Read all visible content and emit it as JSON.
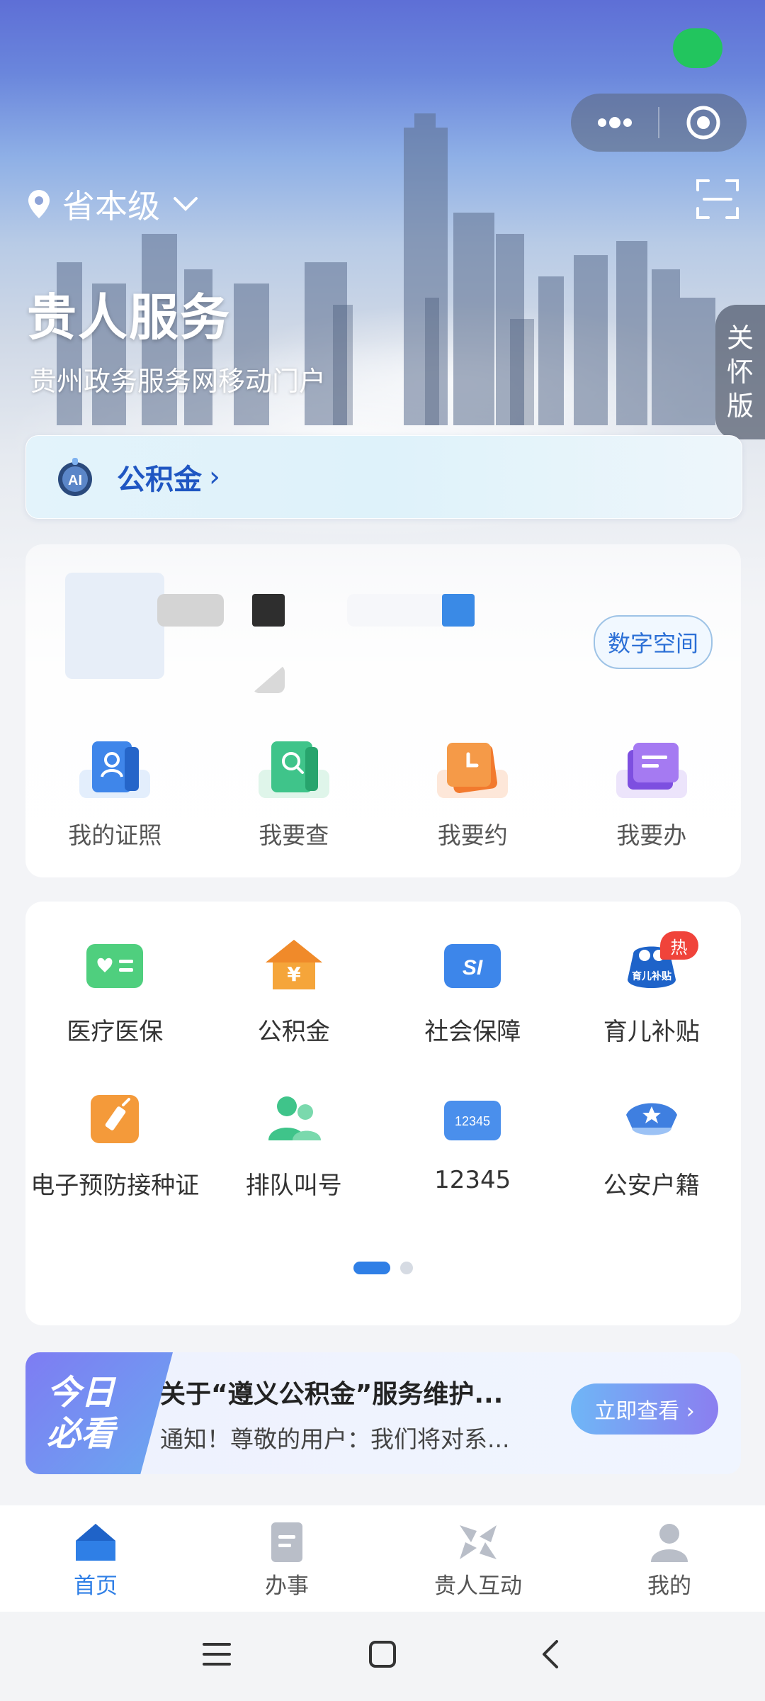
{
  "colors": {
    "accent": "#2f7fe6",
    "status_capsule": "#22c55e",
    "hot_badge": "#f0433a",
    "ai_label": "#1f56c2"
  },
  "header": {
    "location": "省本级",
    "title": "贵人服务",
    "subtitle": "贵州政务服务网移动门户",
    "care_mode": [
      "关",
      "怀",
      "版"
    ]
  },
  "ai_bar": {
    "label": "公积金",
    "arrow": "›"
  },
  "account_card": {
    "digital_space_button": "数字空间",
    "quick_actions": [
      {
        "label": "我的证照",
        "icon": "license-icon"
      },
      {
        "label": "我要查",
        "icon": "search-doc-icon"
      },
      {
        "label": "我要约",
        "icon": "appointment-icon"
      },
      {
        "label": "我要办",
        "icon": "handle-icon"
      }
    ]
  },
  "services": [
    {
      "label": "医疗医保",
      "icon": "medical-card-icon"
    },
    {
      "label": "公积金",
      "icon": "housing-fund-icon"
    },
    {
      "label": "社会保障",
      "icon": "social-security-icon",
      "icon_text": "SI"
    },
    {
      "label": "育儿补贴",
      "icon": "childcare-subsidy-icon",
      "badge": "热",
      "icon_text": "育儿补贴"
    },
    {
      "label": "电子预防接种证",
      "icon": "vaccine-icon"
    },
    {
      "label": "排队叫号",
      "icon": "queue-icon"
    },
    {
      "label": "12345",
      "icon": "hotline-icon",
      "icon_text": "12345"
    },
    {
      "label": "公安户籍",
      "icon": "police-icon"
    }
  ],
  "pager": {
    "pages": 2,
    "current": 1
  },
  "notice": {
    "badge_line1": "今日",
    "badge_line2": "必看",
    "title": "关于“遵义公积金”服务维护...",
    "body": "通知！尊敬的用户：我们将对系...",
    "button": "立即查看 ›"
  },
  "tabbar": [
    {
      "label": "首页",
      "icon": "home-icon",
      "active": true
    },
    {
      "label": "办事",
      "icon": "document-icon",
      "active": false
    },
    {
      "label": "贵人互动",
      "icon": "interaction-icon",
      "active": false
    },
    {
      "label": "我的",
      "icon": "profile-icon",
      "active": false
    }
  ]
}
